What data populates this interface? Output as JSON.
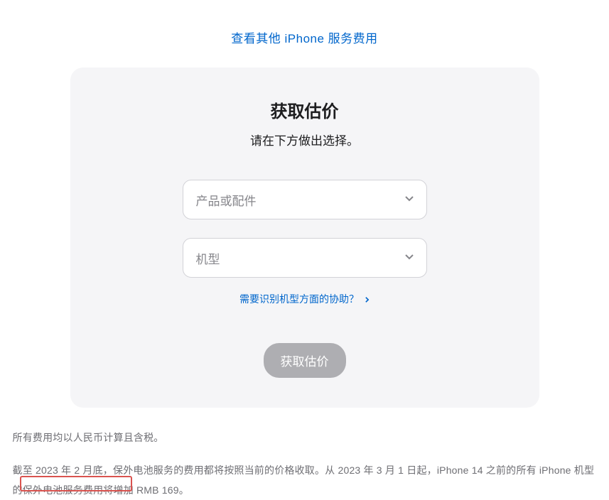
{
  "topLink": {
    "label": "查看其他 iPhone 服务费用"
  },
  "card": {
    "title": "获取估价",
    "subtitle": "请在下方做出选择。",
    "productSelect": {
      "placeholder": "产品或配件"
    },
    "modelSelect": {
      "placeholder": "机型"
    },
    "helpLink": {
      "label": "需要识别机型方面的协助？"
    },
    "button": {
      "label": "获取估价"
    }
  },
  "footnotes": {
    "note1": "所有费用均以人民币计算且含税。",
    "note2": "截至 2023 年 2 月底，保外电池服务的费用都将按照当前的价格收取。从 2023 年 3 月 1 日起，iPhone 14 之前的所有 iPhone 机型的保外电池服务费用将增加 RMB 169。"
  }
}
